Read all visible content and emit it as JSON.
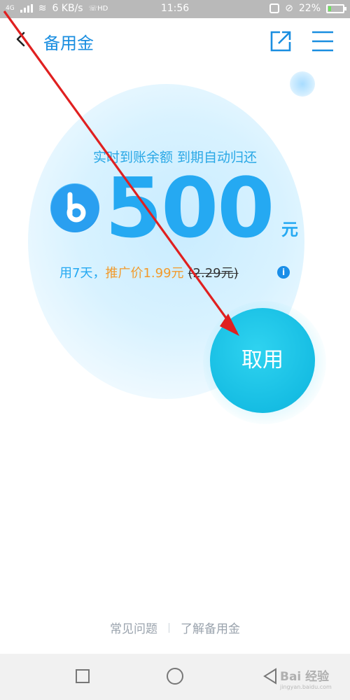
{
  "status_bar": {
    "net_type": "4G",
    "speed": "6 KB/s",
    "volte": "HD",
    "time": "11:56",
    "battery": "22%",
    "battery_level": 0.22
  },
  "header": {
    "title": "备用金"
  },
  "hero": {
    "subtitle": "实时到账余额 到期自动归还",
    "amount": "500",
    "unit": "元",
    "days": "用7天，",
    "promo": "推广价1.99元",
    "original": "(2.29元)"
  },
  "cta": {
    "label": "取用"
  },
  "footer": {
    "faq": "常见问题",
    "learn": "了解备用金"
  },
  "watermark": {
    "brand": "Bai 经验",
    "url": "jingyan.baidu.com"
  },
  "icons": {
    "back": "chevron-left-icon",
    "share": "share-external-icon",
    "menu": "hamburger-menu-icon",
    "coin": "b-coin-icon",
    "info": "info-icon"
  },
  "colors": {
    "primary_blue": "#1a8ee0",
    "promo_orange": "#f29a2a",
    "cta_cyan": "#16bde3",
    "annotation_red": "#e02020"
  }
}
